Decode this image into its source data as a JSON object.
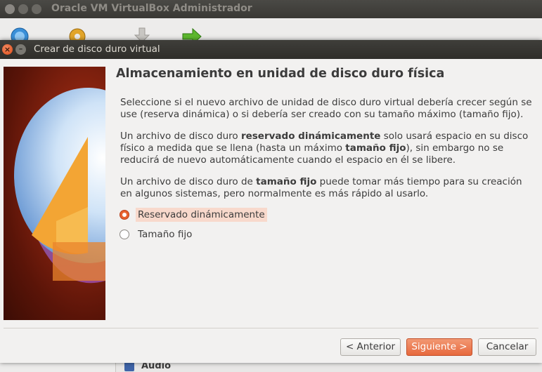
{
  "main_window": {
    "title": "Oracle VM VirtualBox Administrador",
    "details_section": "Audio"
  },
  "dialog": {
    "title": "Crear de disco duro virtual",
    "heading": "Almacenamiento en unidad de disco duro física",
    "paragraph1": "Seleccione si el nuevo archivo de unidad de disco duro virtual debería crecer según se use (reserva dinámica) o si debería ser creado con su tamaño máximo (tamaño fijo).",
    "paragraph2": {
      "part1": "Un archivo de disco duro ",
      "bold1": "reservado dinámicamente",
      "part2": " solo usará espacio en su disco físico a medida que se llena (hasta un máximo ",
      "bold2": "tamaño fijo",
      "part3": "), sin embargo no se reducirá de nuevo automáticamente cuando el espacio en él se libere."
    },
    "paragraph3": {
      "part1": "Un archivo de disco duro de ",
      "bold1": "tamaño fijo",
      "part2": " puede tomar más tiempo para su creación en algunos sistemas, pero normalmente es más rápido al usarlo."
    },
    "options": [
      {
        "label": "Reservado dinámicamente",
        "selected": true
      },
      {
        "label": "Tamaño fijo",
        "selected": false
      }
    ],
    "buttons": {
      "back": "< Anterior",
      "next": "Siguiente >",
      "cancel": "Cancelar"
    }
  },
  "icons": {
    "toolbar": [
      "new-machine-icon",
      "settings-icon",
      "discard-icon",
      "start-icon"
    ],
    "close": "close-icon",
    "minimize": "minimize-icon"
  },
  "colors": {
    "accent": "#e8622f",
    "titlebar": "#3c3b37",
    "dialog_bg": "#f2f1f0"
  }
}
